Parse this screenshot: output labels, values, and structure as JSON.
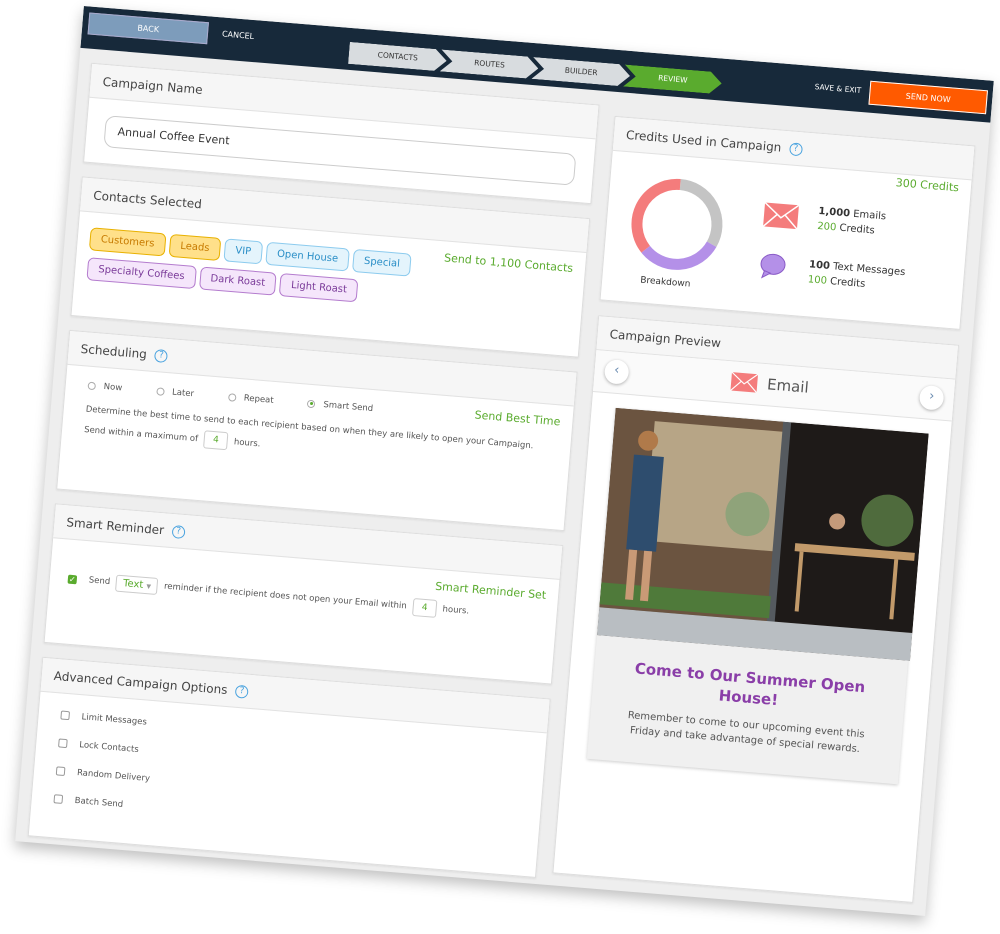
{
  "topbar": {
    "back": "BACK",
    "cancel": "CANCEL",
    "steps": [
      "CONTACTS",
      "ROUTES",
      "BUILDER",
      "REVIEW"
    ],
    "active_step": "REVIEW",
    "save_exit": "SAVE & EXIT",
    "send_now": "SEND NOW"
  },
  "campaign_name": {
    "title": "Campaign Name",
    "value": "Annual Coffee Event"
  },
  "contacts": {
    "title": "Contacts Selected",
    "summary": "Send to 1,100 Contacts",
    "tags": [
      {
        "label": "Customers",
        "color": "yellow"
      },
      {
        "label": "Leads",
        "color": "yellow"
      },
      {
        "label": "VIP",
        "color": "blue"
      },
      {
        "label": "Open House",
        "color": "blue"
      },
      {
        "label": "Special",
        "color": "blue"
      },
      {
        "label": "Specialty Coffees",
        "color": "purple"
      },
      {
        "label": "Dark Roast",
        "color": "purple"
      },
      {
        "label": "Light Roast",
        "color": "purple"
      }
    ]
  },
  "scheduling": {
    "title": "Scheduling",
    "summary": "Send Best Time",
    "options": [
      "Now",
      "Later",
      "Repeat",
      "Smart Send"
    ],
    "selected": "Smart Send",
    "description": "Determine the best time to send to each recipient based on when they are likely to open your Campaign.",
    "within_label": "Send within a maximum of",
    "hours_value": "4",
    "hours_label": "hours."
  },
  "smart_reminder": {
    "title": "Smart Reminder",
    "summary": "Smart Reminder Set",
    "checked": true,
    "send_label": "Send",
    "type_value": "Text",
    "middle_text": "reminder if the recipient does not open your Email within",
    "hours_value": "4",
    "hours_label": "hours."
  },
  "advanced": {
    "title": "Advanced Campaign Options",
    "options": [
      "Limit Messages",
      "Lock Contacts",
      "Random Delivery",
      "Batch Send"
    ]
  },
  "credits": {
    "title": "Credits Used in Campaign",
    "total": "300 Credits",
    "breakdown_label": "Breakdown",
    "donut": [
      {
        "label": "gray",
        "share": 0.32,
        "color": "#c4c4c4"
      },
      {
        "label": "text",
        "share": 0.31,
        "color": "#b490e8"
      },
      {
        "label": "email",
        "share": 0.37,
        "color": "#f47c7c"
      }
    ],
    "email": {
      "count": "1,000",
      "unit": "Emails",
      "credits": "200",
      "credits_label": "Credits"
    },
    "text": {
      "count": "100",
      "unit": "Text Messages",
      "credits": "100",
      "credits_label": "Credits"
    }
  },
  "preview": {
    "title": "Campaign Preview",
    "channel": "Email",
    "headline": "Come to Our Summer Open House!",
    "body": "Remember to come to our upcoming event this Friday and take advantage of special rewards."
  },
  "colors": {
    "accent_green": "#5aab2e",
    "send_orange": "#ff5a00",
    "nav_dark": "#17293a",
    "email_pink": "#f47c7c",
    "text_purple": "#b490e8",
    "headline_purple": "#8a3ea8"
  }
}
